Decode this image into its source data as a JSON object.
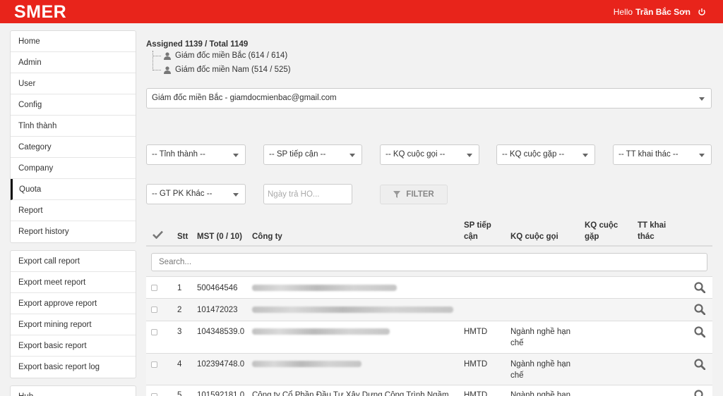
{
  "header": {
    "logo": "SMER",
    "hello": "Hello",
    "user": "Trần Bắc Sơn"
  },
  "sidebar": {
    "group1": [
      "Home",
      "Admin",
      "User",
      "Config",
      "Tỉnh thành",
      "Category",
      "Company",
      "Quota",
      "Report",
      "Report history"
    ],
    "active": "Quota",
    "group2": [
      "Export call report",
      "Export meet report",
      "Export approve report",
      "Export mining report",
      "Export basic report",
      "Export basic report log"
    ],
    "group3": [
      "Hub"
    ]
  },
  "summary": {
    "assigned": "Assigned 1139 / Total 1149",
    "tree": [
      "Giám đốc miền Bắc (614 / 614)",
      "Giám đốc miền Nam (514 / 525)"
    ]
  },
  "manager_select": "Giám đốc miền Bắc - giamdocmienbac@gmail.com",
  "filters": {
    "tinh_thanh": "-- Tỉnh thành --",
    "sp_tiep_can": "-- SP tiếp cận --",
    "kq_cuoc_goi": "-- KQ cuộc gọi --",
    "kq_cuoc_gap": "-- KQ cuộc gặp --",
    "tt_khai_thac": "-- TT khai thác --",
    "gt_pk_khac": "-- GT PK Khác --",
    "date_placeholder": "Ngày trả HO...",
    "filter_button": "FILTER"
  },
  "table": {
    "headers": {
      "stt": "Stt",
      "mst": "MST (0 / 10)",
      "cong_ty": "Công ty",
      "sp_tiep_can_1": "SP tiếp",
      "sp_tiep_can_2": "cận",
      "kq_cuoc_goi": "KQ cuộc gọi",
      "kq_cuoc_gap_1": "KQ cuộc",
      "kq_cuoc_gap_2": "gặp",
      "tt_khai_thac_1": "TT khai",
      "tt_khai_thac_2": "thác"
    },
    "search_placeholder": "Search...",
    "rows": [
      {
        "stt": "1",
        "mst": "500464546",
        "sp": "",
        "kq1": "",
        "kq2": ""
      },
      {
        "stt": "2",
        "mst": "101472023",
        "sp": "",
        "kq1": "",
        "kq2": ""
      },
      {
        "stt": "3",
        "mst": "104348539.0",
        "sp": "HMTD",
        "kq1": "Ngành nghề hạn",
        "kq2": "chế"
      },
      {
        "stt": "4",
        "mst": "102394748.0",
        "sp": "HMTD",
        "kq1": "Ngành nghề hạn",
        "kq2": "chế"
      },
      {
        "stt": "5",
        "mst": "101592181.0",
        "sp": "HMTD",
        "kq1": "Ngành nghề hạn",
        "kq2": ""
      }
    ],
    "row5_company": "Công ty Cổ Phần Đầu Tư Xây Dựng Công Trình Ngầm"
  },
  "colors": {
    "brand": "#e8241b",
    "header_text": "#ffffff"
  }
}
